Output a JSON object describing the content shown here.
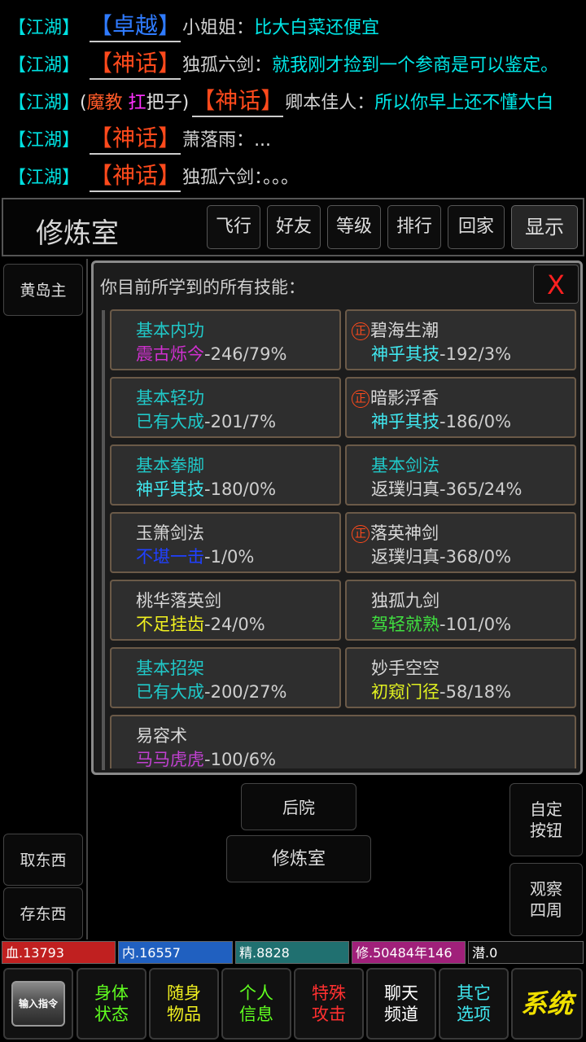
{
  "chat": [
    {
      "channel": "【江湖】",
      "rank": "【卓越】",
      "speaker": "小姐姐",
      "colon": "：",
      "message": "比大白菜还便宜"
    },
    {
      "channel": "【江湖】",
      "rank": "【神话】",
      "speaker": "独孤六剑",
      "colon": "：",
      "message": "就我刚才捡到一个参商是可以鉴定。"
    },
    {
      "channel": "【江湖】",
      "prefix_open": "(",
      "prefix_a": "魔教",
      "prefix_b": "扛",
      "prefix_c": "把子",
      "prefix_close": ")",
      "rank": "【神话】",
      "speaker": "卿本佳人",
      "colon": "：",
      "message": "所以你早上还不懂大白"
    },
    {
      "channel": "【江湖】",
      "rank": "【神话】",
      "speaker": "萧落雨",
      "colon": "：",
      "message": "..."
    },
    {
      "channel": "【江湖】",
      "rank": "【神话】",
      "speaker": "独孤六剑",
      "colon": "：",
      "message": "。。。"
    }
  ],
  "topbar": {
    "title": "修炼室",
    "buttons": [
      "飞行",
      "好友",
      "等级",
      "排行",
      "回家",
      "显示"
    ]
  },
  "left": {
    "npc": "黄岛主",
    "take": "取东西",
    "store": "存东西"
  },
  "panel": {
    "title": "你目前所学到的所有技能：",
    "close": "X",
    "zheng": "正",
    "skills": [
      {
        "name": "基本内功",
        "level": "震古烁今",
        "stats": "-246/79%",
        "name_color": "#20c8c8",
        "level_color": "#d030d0",
        "zheng": false
      },
      {
        "name": "碧海生潮",
        "level": "神乎其技",
        "stats": "-192/3%",
        "name_color": "#d8d8d8",
        "level_color": "#40e8f0",
        "zheng": true
      },
      {
        "name": "基本轻功",
        "level": "已有大成",
        "stats": "-201/7%",
        "name_color": "#20c8c8",
        "level_color": "#20c8c8",
        "zheng": false
      },
      {
        "name": "暗影浮香",
        "level": "神乎其技",
        "stats": "-186/0%",
        "name_color": "#d8d8d8",
        "level_color": "#40e8f0",
        "zheng": true
      },
      {
        "name": "基本拳脚",
        "level": "神乎其技",
        "stats": "-180/0%",
        "name_color": "#20c8c8",
        "level_color": "#40e8f0",
        "zheng": false
      },
      {
        "name": "基本剑法",
        "level": "返璞归真",
        "stats": "-365/24%",
        "name_color": "#20c8c8",
        "level_color": "#d8d8d8",
        "zheng": false
      },
      {
        "name": "玉箫剑法",
        "level": "不堪一击",
        "stats": "-1/0%",
        "name_color": "#d8d8d8",
        "level_color": "#2040ff",
        "zheng": false
      },
      {
        "name": "落英神剑",
        "level": "返璞归真",
        "stats": "-368/0%",
        "name_color": "#d8d8d8",
        "level_color": "#d8d8d8",
        "zheng": true
      },
      {
        "name": "桃华落英剑",
        "level": "不足挂齿",
        "stats": "-24/0%",
        "name_color": "#d8d8d8",
        "level_color": "#f0f020",
        "zheng": false
      },
      {
        "name": "独孤九剑",
        "level": "驾轻就熟",
        "stats": "-101/0%",
        "name_color": "#d8d8d8",
        "level_color": "#40e040",
        "zheng": false
      },
      {
        "name": "基本招架",
        "level": "已有大成",
        "stats": "-200/27%",
        "name_color": "#20c8c8",
        "level_color": "#20c8c8",
        "zheng": false
      },
      {
        "name": "妙手空空",
        "level": "初窥门径",
        "stats": "-58/18%",
        "name_color": "#d8d8d8",
        "level_color": "#e0f020",
        "zheng": false
      },
      {
        "name": "易容术",
        "level": "马马虎虎",
        "stats": "-100/6%",
        "name_color": "#d8d8d8",
        "level_color": "#c040d0",
        "zheng": false
      }
    ]
  },
  "room": {
    "north": "后院",
    "current": "修炼室",
    "custom_line1": "自定",
    "custom_line2": "按钮",
    "look_line1": "观察",
    "look_line2": "四周"
  },
  "stats": [
    {
      "label": "血.13793",
      "color": "#c02020"
    },
    {
      "label": "内.16557",
      "color": "#2060c0"
    },
    {
      "label": "精.8828",
      "color": "#207070"
    },
    {
      "label": "修.50484年146",
      "color": "#a0207a"
    },
    {
      "label": "潜.0",
      "color": "#101010"
    }
  ],
  "bottom": {
    "cmd": "输入指令",
    "buttons": [
      {
        "line1": "身体",
        "line2": "状态",
        "color": "#60ff20"
      },
      {
        "line1": "随身",
        "line2": "物品",
        "color": "#f0f020"
      },
      {
        "line1": "个人",
        "line2": "信息",
        "color": "#60ff20"
      },
      {
        "line1": "特殊",
        "line2": "攻击",
        "color": "#ff3030"
      },
      {
        "line1": "聊天",
        "line2": "频道",
        "color": "#ffffff"
      },
      {
        "line1": "其它",
        "line2": "选项",
        "color": "#40e8f0"
      }
    ],
    "system": "系统"
  }
}
